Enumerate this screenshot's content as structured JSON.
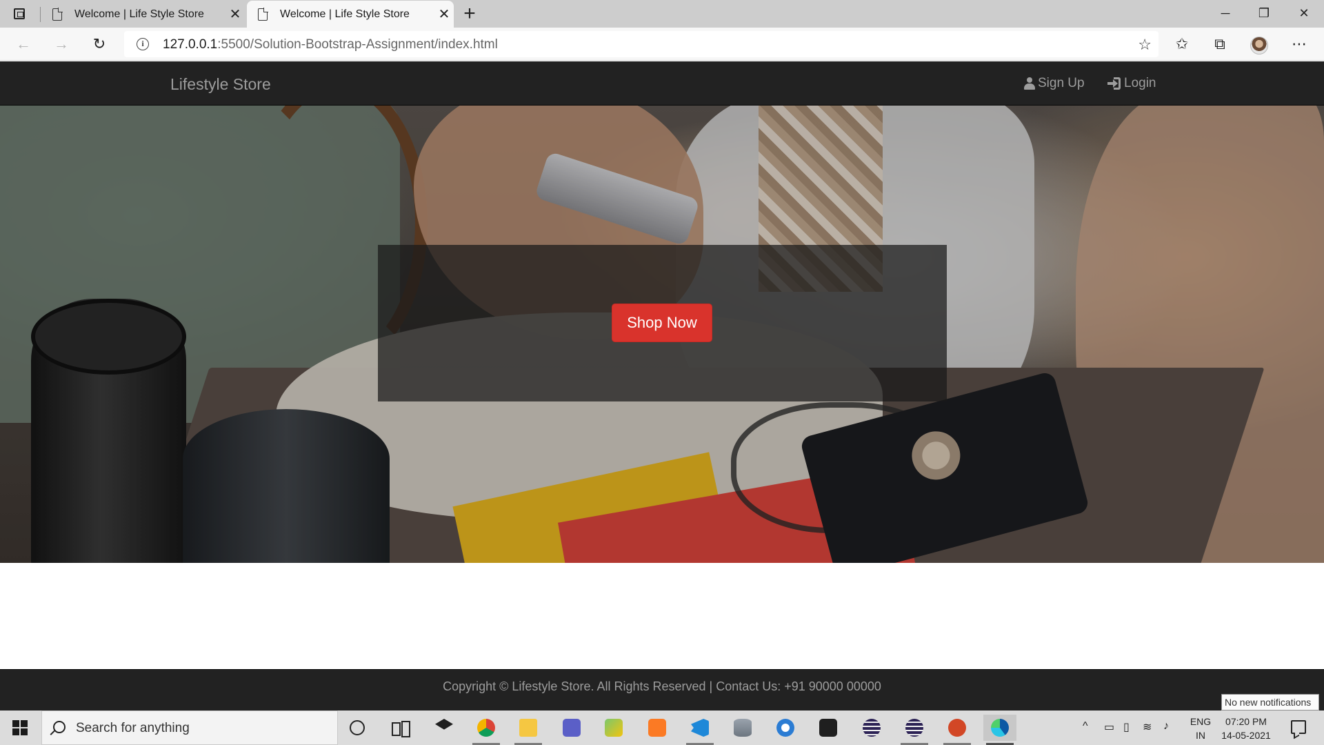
{
  "browser": {
    "tabs": [
      {
        "title": "Welcome | Life Style Store",
        "active": false
      },
      {
        "title": "Welcome | Life Style Store",
        "active": true
      }
    ],
    "new_tab_label": "+",
    "url_host": "127.0.0.1",
    "url_rest": ":5500/Solution-Bootstrap-Assignment/index.html",
    "window_controls": {
      "minimize": "─",
      "restore": "❐",
      "close": "✕"
    },
    "toolbar_icons": [
      "back-icon",
      "forward-icon",
      "refresh-icon",
      "info-icon",
      "add-favorite-icon",
      "favorites-icon",
      "collections-icon",
      "profile-avatar",
      "more-icon"
    ]
  },
  "site": {
    "brand": "Lifestyle Store",
    "nav": {
      "signup_label": "Sign Up",
      "login_label": "Login"
    },
    "hero": {
      "button_label": "Shop Now"
    },
    "footer": {
      "text": "Copyright © Lifestyle Store. All Rights Reserved | Contact Us: +91 90000 00000"
    },
    "colors": {
      "navbar_bg": "#222222",
      "nav_text": "#9d9d9d",
      "button_bg": "#d9332c"
    }
  },
  "taskbar": {
    "search_placeholder": "Search for anything",
    "notification_tooltip": "No new notifications",
    "language": {
      "line1": "ENG",
      "line2": "IN"
    },
    "clock": {
      "time": "07:20 PM",
      "date": "14-05-2021"
    },
    "apps": [
      "cortana-icon",
      "task-view-icon",
      "dropbox-icon",
      "chrome-icon",
      "file-explorer-icon",
      "teams-icon",
      "paint-icon",
      "xampp-icon",
      "vscode-icon",
      "database-icon",
      "word-icon",
      "visual-studio-icon",
      "eclipse-icon",
      "eclipse-icon-2",
      "powerpoint-icon",
      "edge-icon"
    ]
  }
}
